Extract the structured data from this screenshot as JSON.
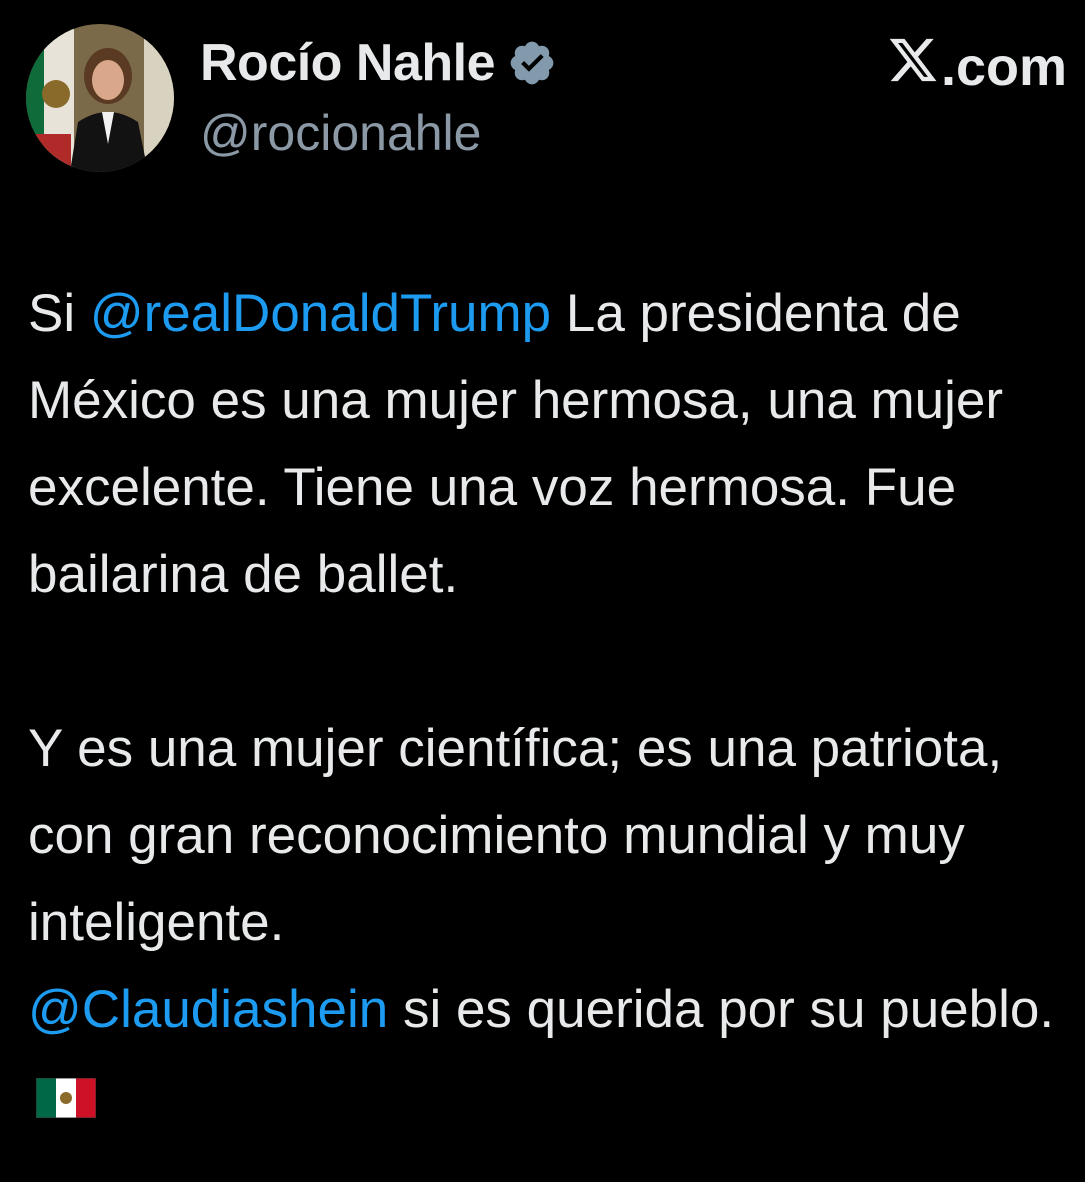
{
  "header": {
    "display_name": "Rocío Nahle",
    "handle": "@rocionahle",
    "site": ".com"
  },
  "tweet": {
    "p1_lead": "Si ",
    "mention1": "@realDonaldTrump",
    "p1_rest": "  La presidenta de México es una mujer hermosa, una mujer excelente. Tiene una voz hermosa. Fue bailarina de ballet.",
    "p2": "Y es una mujer científica; es una patriota, con gran reconocimiento mundial y muy inteligente.",
    "mention2": "@Claudiashein",
    "p3_rest": " si es querida por su pueblo. "
  },
  "icons": {
    "verified": "verified-badge-icon",
    "x_logo": "x-logo-icon",
    "flag": "mexico-flag-icon"
  },
  "colors": {
    "background": "#000000",
    "text": "#e7e9ea",
    "secondary": "#8b98a5",
    "link": "#1d9bf0"
  }
}
